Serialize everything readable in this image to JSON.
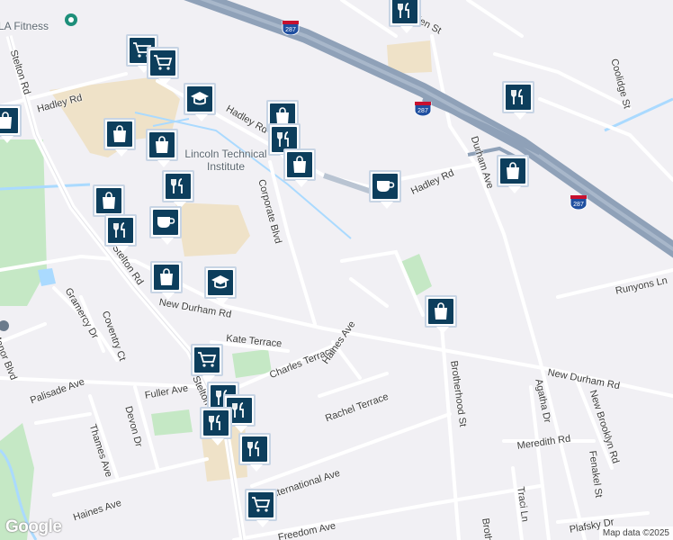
{
  "map": {
    "attribution": "Map data ©2025",
    "logo": "Google",
    "colors": {
      "background": "#f1f0f4",
      "highway": "#8fa1b8",
      "highway_inner": "#a8b7ca",
      "road": "#ffffff",
      "water": "#aadaff",
      "park": "#c5e8c5",
      "campus": "#efe2c8",
      "marker_fill": "#0d3e5c",
      "marker_border": "#c7d4e4",
      "shield_red": "#c8102e",
      "shield_blue": "#1f4fa0"
    }
  },
  "poi_labels": {
    "fitness": "LA Fitness",
    "school": "Lincoln Technical Institute"
  },
  "street_labels": {
    "helen": "Helen St",
    "coolidge": "Coolidge St",
    "hadley_w": "Hadley Rd",
    "hadley_c": "Hadley Rd",
    "hadley_e": "Hadley Rd",
    "durham": "Durham Ave",
    "stelton_n": "Stelton Rd",
    "stelton_s": "Stelton Rd",
    "stelton_low": "Stelton Rd",
    "corporate": "Corporate Blvd",
    "new_durham_w": "New Durham Rd",
    "new_durham_e": "New Durham Rd",
    "runyons": "Runyons Ln",
    "kate": "Kate Terrace",
    "charles": "Charles Terrace",
    "haines_ave_n": "Haines Ave",
    "rachel": "Rachel Terrace",
    "fuller": "Fuller Ave",
    "gramercy": "Gramercy Dr",
    "coventry": "Coventry Ct",
    "palisade": "Palisade Ave",
    "manor": "Manor Blvd",
    "devon": "Devon Dr",
    "thames": "Thames Ave",
    "haines_ave_s": "Haines Ave",
    "international": "International Ave",
    "freedom": "Freedom Ave",
    "brotherhood": "Brotherhood St",
    "brotherhood_s": "Broth",
    "agatha": "Agatha Dr",
    "new_brooklyn": "New Brooklyn Rd",
    "meredith": "Meredith Rd",
    "fenakel": "Fenakel St",
    "traci": "Traci Ln",
    "plafsky": "Plafsky Dr"
  },
  "shields": [
    "287",
    "287",
    "287"
  ],
  "markers": [
    {
      "type": "restaurant",
      "icon": "fork-knife-icon"
    },
    {
      "type": "grocery",
      "icon": "cart-icon"
    },
    {
      "type": "grocery",
      "icon": "cart-icon"
    },
    {
      "type": "school",
      "icon": "graduation-cap-icon"
    },
    {
      "type": "restaurant",
      "icon": "fork-knife-icon"
    },
    {
      "type": "shop",
      "icon": "bag-icon"
    },
    {
      "type": "restaurant",
      "icon": "fork-knife-icon"
    },
    {
      "type": "shop",
      "icon": "bag-icon"
    },
    {
      "type": "shop",
      "icon": "bag-icon"
    },
    {
      "type": "shop",
      "icon": "bag-icon"
    },
    {
      "type": "shop",
      "icon": "bag-icon"
    },
    {
      "type": "cafe",
      "icon": "coffee-cup-icon"
    },
    {
      "type": "shop",
      "icon": "bag-icon"
    },
    {
      "type": "restaurant",
      "icon": "fork-knife-icon"
    },
    {
      "type": "shop",
      "icon": "bag-icon"
    },
    {
      "type": "cafe",
      "icon": "coffee-cup-icon"
    },
    {
      "type": "restaurant",
      "icon": "fork-knife-icon"
    },
    {
      "type": "shop",
      "icon": "bag-icon"
    },
    {
      "type": "school",
      "icon": "graduation-cap-icon"
    },
    {
      "type": "shop",
      "icon": "bag-icon"
    },
    {
      "type": "grocery",
      "icon": "cart-icon"
    },
    {
      "type": "restaurant",
      "icon": "fork-knife-icon"
    },
    {
      "type": "restaurant",
      "icon": "fork-knife-icon"
    },
    {
      "type": "restaurant",
      "icon": "fork-knife-icon"
    },
    {
      "type": "restaurant",
      "icon": "fork-knife-icon"
    },
    {
      "type": "grocery",
      "icon": "cart-icon"
    }
  ]
}
